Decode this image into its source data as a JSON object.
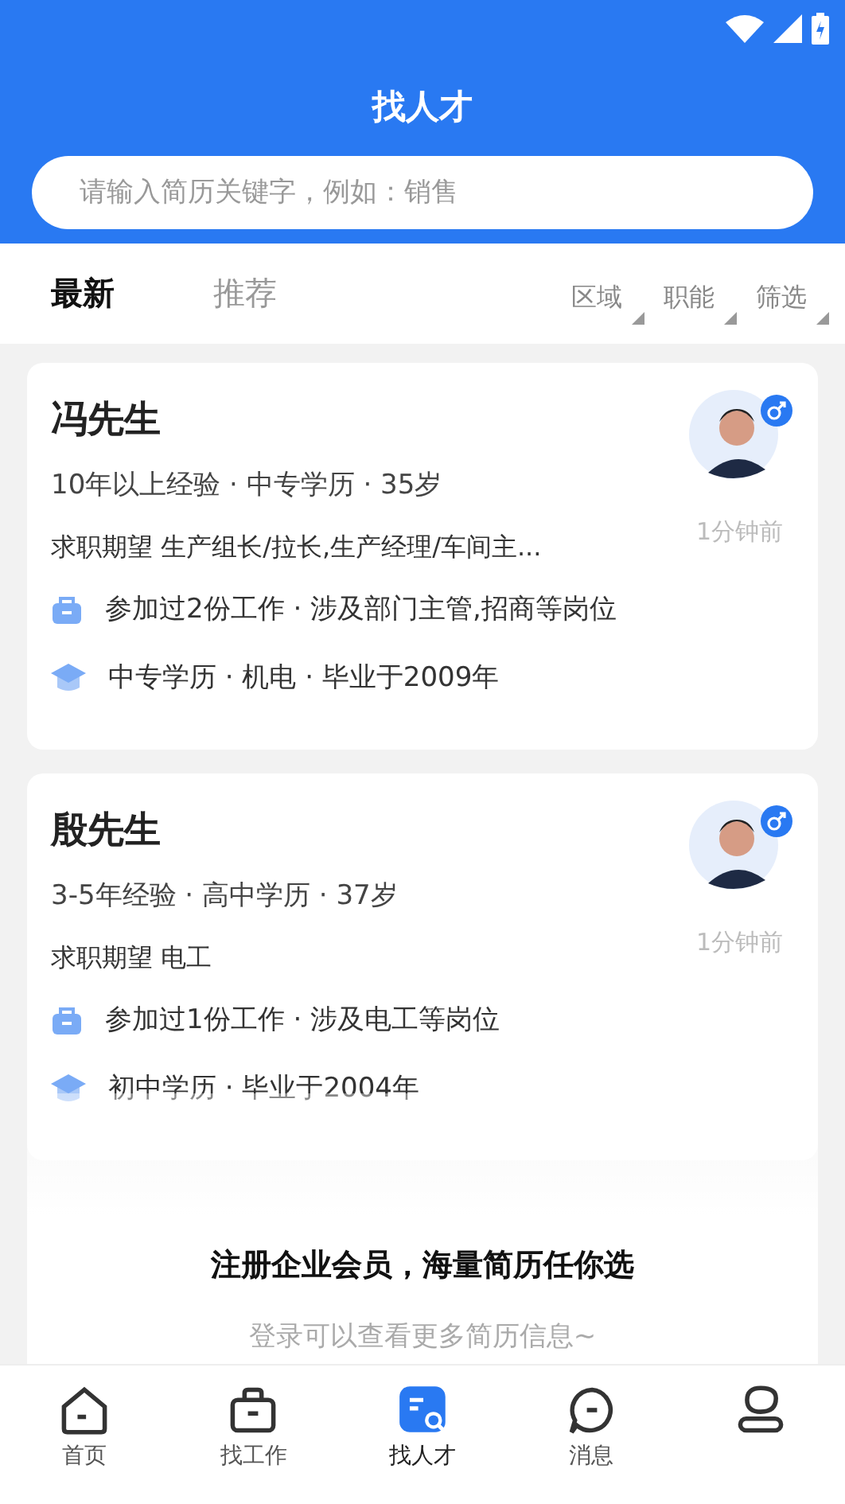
{
  "header": {
    "title": "找人才"
  },
  "search": {
    "placeholder": "请输入简历关键字，例如：销售"
  },
  "tabs": [
    {
      "label": "最新",
      "selected": true
    },
    {
      "label": "推荐",
      "selected": false
    }
  ],
  "filters": [
    "区域",
    "职能",
    "筛选"
  ],
  "candidates": [
    {
      "name": "冯先生",
      "meta": "10年以上经验 · 中专学历 · 35岁",
      "expectation": "求职期望 生产组长/拉长,生产经理/车间主...",
      "time": "1分钟前",
      "work": "参加过2份工作 · 涉及部门主管,招商等岗位",
      "education": "中专学历 · 机电 · 毕业于2009年"
    },
    {
      "name": "殷先生",
      "meta": "3-5年经验 · 高中学历 · 37岁",
      "expectation": "求职期望 电工",
      "time": "1分钟前",
      "work": "参加过1份工作 · 涉及电工等岗位",
      "education": "初中学历 · 毕业于2004年"
    }
  ],
  "promo": {
    "title": "注册企业会员，海量简历任你选",
    "subtitle": "登录可以查看更多简历信息~"
  },
  "nav": [
    {
      "kind": "home",
      "label": "首页",
      "selected": false
    },
    {
      "kind": "briefcase",
      "label": "找工作",
      "selected": false
    },
    {
      "kind": "talent",
      "label": "找人才",
      "selected": true
    },
    {
      "kind": "message",
      "label": "消息",
      "selected": false
    },
    {
      "kind": "person",
      "selected": false
    }
  ]
}
